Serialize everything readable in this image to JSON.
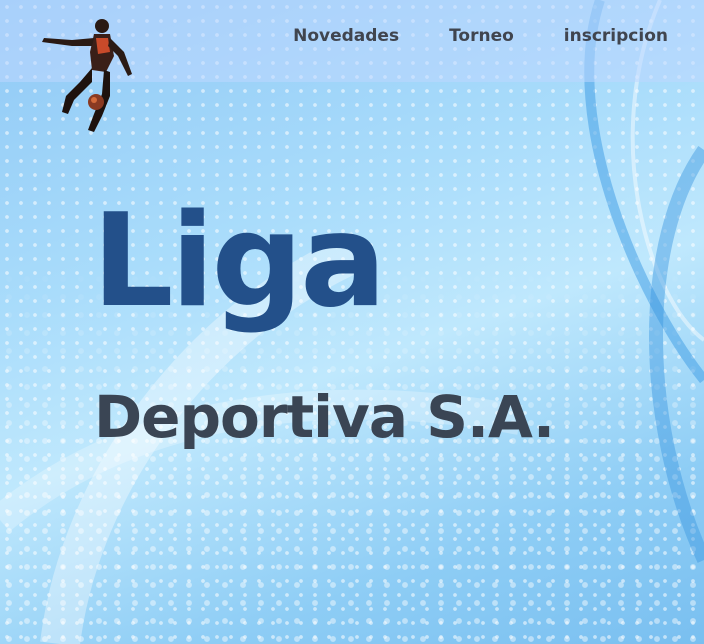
{
  "nav": {
    "items": [
      {
        "label": "Novedades"
      },
      {
        "label": "Torneo"
      },
      {
        "label": "inscripcion"
      }
    ]
  },
  "hero": {
    "title": "Liga",
    "subtitle": "Deportiva S.A."
  },
  "colors": {
    "title": "#23508a",
    "subtitle": "#3a4554",
    "nav_text": "#40454f",
    "background": "#a9dcfb"
  },
  "icons": {
    "logo": "soccer-player-icon"
  }
}
